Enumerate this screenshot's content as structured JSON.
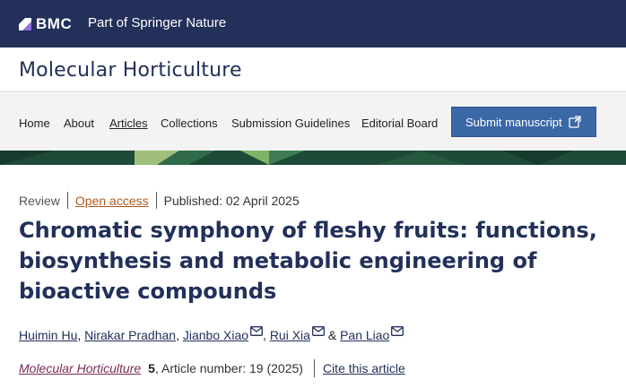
{
  "header": {
    "logo_text": "BMC",
    "partner_text": "Part of Springer Nature"
  },
  "journal": {
    "title": "Molecular Horticulture"
  },
  "nav": {
    "items": [
      "Home",
      "About",
      "Articles",
      "Collections",
      "Submission Guidelines",
      "Editorial Board"
    ],
    "active": "Articles",
    "submit_label": "Submit manuscript"
  },
  "article": {
    "type": "Review",
    "access": "Open access",
    "published": "Published: 02 April 2025",
    "title": "Chromatic symphony of fleshy fruits: functions, biosynthesis and metabolic engineering of bioactive compounds",
    "authors": [
      "Huimin Hu",
      "Nirakar Pradhan",
      "Jianbo Xiao",
      "Rui Xia",
      "Pan Liao"
    ],
    "author_separators": [
      ", ",
      ", ",
      ", ",
      " & "
    ],
    "citation": {
      "journal": "Molecular Horticulture",
      "volume": "5",
      "article_number": ", Article number: 19 (2025)",
      "cite_label": "Cite this article"
    }
  },
  "colors": {
    "brand_navy": "#22305a",
    "submit_blue": "#3a68a7",
    "open_access_orange": "#b05a1a",
    "journal_link_purple": "#7b2b5a",
    "banner_green": "#1e4a38"
  },
  "icons": {
    "logo": "bmc-logo-icon",
    "external": "external-link-icon",
    "mail": "mail-icon"
  }
}
